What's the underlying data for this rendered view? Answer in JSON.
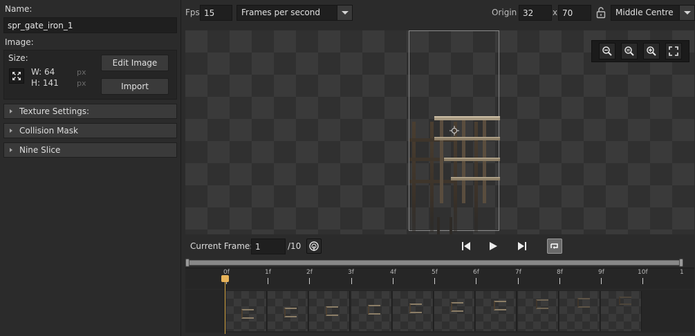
{
  "left_panel": {
    "name_label": "Name:",
    "name_value": "spr_gate_iron_1",
    "image_label": "Image:",
    "size_label": "Size:",
    "width_prefix": "W:",
    "width_value": "64",
    "height_prefix": "H:",
    "height_value": "141",
    "unit": "px",
    "edit_image_label": "Edit Image",
    "import_label": "Import",
    "sections": [
      {
        "label": "Texture Settings:"
      },
      {
        "label": "Collision Mask"
      },
      {
        "label": "Nine Slice"
      }
    ]
  },
  "topbar": {
    "fps_label": "Fps",
    "fps_value": "15",
    "speed_mode": "Frames per second",
    "origin_label": "Origin",
    "origin_x": "32",
    "origin_sep": "x",
    "origin_y": "70",
    "origin_preset": "Middle Centre"
  },
  "icons": {
    "size_icon": "expand-arrows-icon",
    "lock_icon": "lock-open-icon",
    "zoom_out": "zoom-out-icon",
    "zoom_reset": "zoom-reset-icon",
    "zoom_in": "zoom-in-icon",
    "fit": "fit-to-screen-icon",
    "first_frame": "skip-back-icon",
    "play": "play-icon",
    "last_frame": "skip-forward-icon",
    "loop": "loop-icon",
    "onion": "onion-skin-icon"
  },
  "playback": {
    "current_frame_label": "Current Frame:",
    "current_frame_value": "1",
    "total_frames": "/10"
  },
  "timeline": {
    "ticks": [
      "0f",
      "1f",
      "2f",
      "3f",
      "4f",
      "5f",
      "6f",
      "7f",
      "8f",
      "9f",
      "10f",
      "1"
    ],
    "frame_count": 10
  },
  "colors": {
    "accent": "#e8b45a",
    "panel": "#2b2b2b",
    "field": "#1f1f1f"
  }
}
